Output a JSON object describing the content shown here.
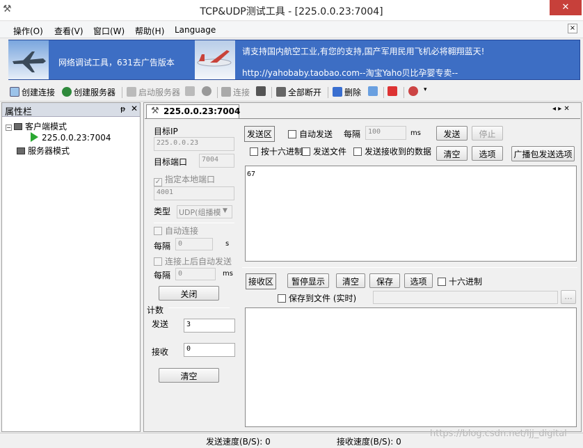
{
  "window": {
    "title": "TCP&UDP测试工具 - [225.0.0.23:7004]",
    "close": "✕"
  },
  "menu": {
    "items": [
      "操作(O)",
      "查看(V)",
      "窗口(W)",
      "帮助(H)",
      "Language"
    ],
    "close": "×"
  },
  "banner": {
    "left_text": "网络调试工具，631去广告版本",
    "right_line1": "请支持国内航空工业,有您的支持,国产军用民用飞机必将翱翔蓝天!",
    "right_line2": "http://yahobaby.taobao.com--淘宝Yaho贝比孕婴专卖--"
  },
  "toolbar": {
    "create_connection": "创建连接",
    "create_server": "创建服务器",
    "start_server": "启动服务器",
    "connect": "连接",
    "disconnect_all": "全部断开",
    "delete": "删除"
  },
  "sidebar": {
    "title": "属性栏",
    "pin": "ᵽ",
    "close": "✕",
    "tree": {
      "client_mode": "客户端模式",
      "connection": "225.0.0.23:7004",
      "server_mode": "服务器模式"
    }
  },
  "tab": {
    "label": "225.0.0.23:7004",
    "nav": "◂ ▸ ✕"
  },
  "config": {
    "target_ip_label": "目标IP",
    "target_ip": "225.0.0.23",
    "target_port_label": "目标端口",
    "target_port": "7004",
    "local_port_label": "指定本地端口",
    "local_port": "4001",
    "type_label": "类型",
    "type_value": "UDP(组播模",
    "auto_connect_label": "自动连接",
    "interval_label": "每隔",
    "interval_value": "0",
    "interval_unit": "s",
    "auto_send_after_label": "连接上后自动发送",
    "interval2_label": "每隔",
    "interval2_value": "0",
    "interval2_unit": "ms",
    "close_button": "关闭",
    "count_label": "计数",
    "send_label": "发送",
    "send_count": "3",
    "recv_label": "接收",
    "recv_count": "0",
    "clear_button": "清空"
  },
  "send": {
    "section": "发送区",
    "auto_send": "自动发送",
    "interval_label": "每隔",
    "interval_value": "100",
    "interval_unit": "ms",
    "send_button": "发送",
    "stop_button": "停止",
    "hex_send": "按十六进制",
    "send_file": "发送文件",
    "send_received": "发送接收到的数据",
    "clear_button": "清空",
    "options_button": "选项",
    "broadcast_button": "广播包发送选项",
    "content": "67"
  },
  "receive": {
    "section": "接收区",
    "pause_button": "暂停显示",
    "clear_button": "清空",
    "save_button": "保存",
    "options_button": "选项",
    "hex_display": "十六进制",
    "save_to_file": "保存到文件 (实时)",
    "browse_button": "...",
    "content": ""
  },
  "status": {
    "send_speed": "发送速度(B/S): 0",
    "recv_speed": "接收速度(B/S): 0"
  },
  "watermark": "https://blog.csdn.net/ljj_digital",
  "colors": {
    "accent": "#3d6ec4",
    "close": "#c7403a"
  }
}
